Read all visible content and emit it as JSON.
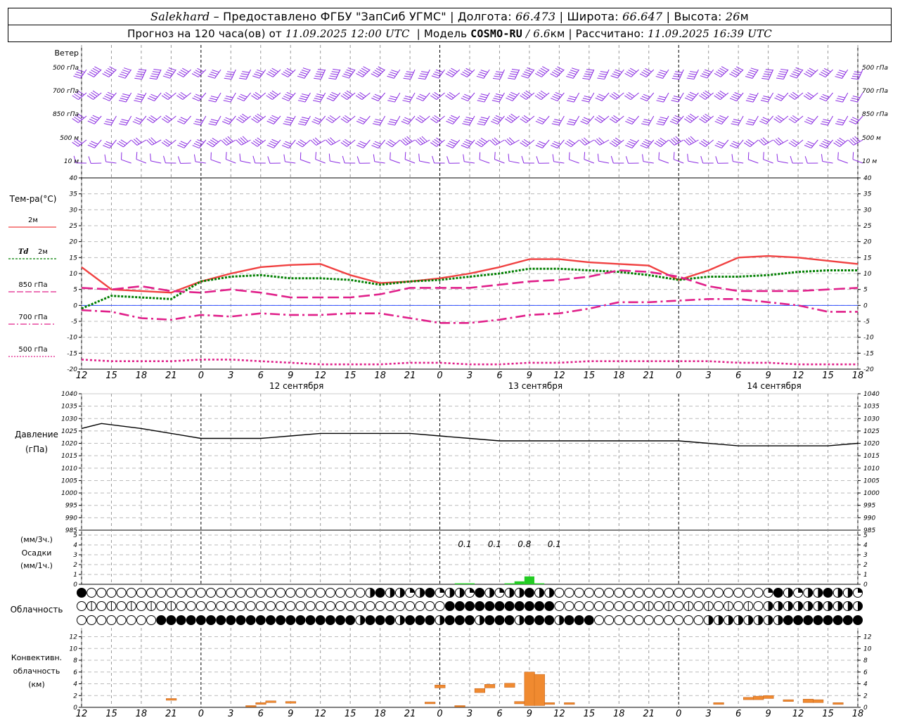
{
  "header": {
    "station": "Salekhard",
    "provided": "– Предоставлено ФГБУ \"ЗапСиб УГМС\" | Долгота:",
    "lon": "66.473",
    "lat_label": "| Широта:",
    "lat": "66.647",
    "alt_label": "| Высота:",
    "alt": "26",
    "alt_unit": "м",
    "forecast_label": "Прогноз на 120 часа(ов) от",
    "issued": "11.09.2025 12:00 UTC",
    "model_label": "| Модель",
    "model": "COSMO-RU",
    "resolution": "/ 6.6",
    "res_unit": "км",
    "calc_label": "| Рассчитано:",
    "calc": "11.09.2025 16:39 UTC"
  },
  "colors": {
    "wind": "#8a2be2",
    "t2m": "#f04040",
    "td2m": "#007f00",
    "t850": "#e0208a",
    "t700": "#e0208a",
    "t500": "#e0208a",
    "pressure": "#000000",
    "precip": "#22cc22",
    "convective": "#f08a30",
    "grid": "#999999"
  },
  "time_axis": {
    "hour_ticks": [
      "12",
      "15",
      "18",
      "21",
      "0",
      "3",
      "6",
      "9",
      "12",
      "15",
      "18",
      "21",
      "0",
      "3",
      "6",
      "9",
      "12",
      "15",
      "18",
      "21",
      "0",
      "3",
      "6",
      "9",
      "12",
      "15",
      "18"
    ],
    "day_labels": [
      "12 сентября",
      "13 сентября",
      "14 сентября"
    ]
  },
  "wind_panel": {
    "title": "Ветер",
    "levels": [
      "500 гПа",
      "700 гПа",
      "850 гПа",
      "500 м",
      "10  м"
    ],
    "right_levels": [
      "500 гПа",
      "700 гПа",
      "850 гПа",
      "500 м",
      "10  м"
    ]
  },
  "temp_panel": {
    "title": "Тем-ра(°C)",
    "legend": [
      {
        "label": "2м",
        "prefix": ""
      },
      {
        "label": "2м",
        "prefix": "Td"
      },
      {
        "label": "850 гПа",
        "prefix": ""
      },
      {
        "label": "700 гПа",
        "prefix": ""
      },
      {
        "label": "500 гПа",
        "prefix": ""
      }
    ],
    "yticks": [
      40,
      35,
      30,
      25,
      20,
      15,
      10,
      5,
      0,
      -5,
      -10,
      -15,
      -20
    ]
  },
  "pressure_panel": {
    "title": "Давление",
    "unit": "(гПа)",
    "yticks": [
      1040,
      1035,
      1030,
      1025,
      1020,
      1015,
      1010,
      1005,
      1000,
      995,
      990,
      985
    ]
  },
  "precip_panel": {
    "unit3": "(мм/3ч.)",
    "title": "Осадки",
    "unit1": "(мм/1ч.)",
    "yticks": [
      5,
      4,
      3,
      2,
      1,
      0
    ],
    "annotations": [
      "0.1",
      "0.1",
      "0.8",
      "0.1"
    ]
  },
  "cloud_panel": {
    "title": "Облачность"
  },
  "convective_panel": {
    "title1": "Конвективн.",
    "title2": "облачность",
    "unit": "(км)",
    "yticks": [
      12,
      10,
      8,
      6,
      4,
      2,
      0
    ]
  },
  "chart_data": {
    "type": "line",
    "x_hours_from_start": "0..78 (12 UTC 11 Sep to 18 UTC 14 Sep)",
    "temperature": {
      "ylim": [
        -20,
        40
      ],
      "series": [
        {
          "name": "2м",
          "x": [
            0,
            3,
            6,
            9,
            12,
            15,
            18,
            21,
            24,
            27,
            30,
            33,
            36,
            39,
            42,
            45,
            48,
            51,
            54,
            57,
            60,
            63,
            66,
            69,
            72,
            75,
            78
          ],
          "values": [
            12,
            5,
            4.5,
            4,
            7.5,
            10,
            12,
            12.7,
            13,
            9.5,
            7,
            7.5,
            8.5,
            10,
            12,
            14.5,
            14.5,
            13.5,
            13,
            12.5,
            8,
            11,
            15,
            15.5,
            15,
            14,
            13
          ]
        },
        {
          "name": "Td 2м",
          "x": [
            0,
            3,
            6,
            9,
            12,
            15,
            18,
            21,
            24,
            27,
            30,
            33,
            36,
            39,
            42,
            45,
            48,
            51,
            54,
            57,
            60,
            63,
            66,
            69,
            72,
            75,
            78
          ],
          "values": [
            -1,
            3,
            2.5,
            2,
            7.5,
            9,
            9.5,
            8.5,
            8.5,
            8,
            6.5,
            7.5,
            8,
            9,
            10,
            11.5,
            11.5,
            11,
            10.5,
            9.5,
            8,
            9,
            9,
            9.5,
            10.5,
            11,
            11
          ]
        },
        {
          "name": "850 гПа",
          "x": [
            0,
            3,
            6,
            9,
            12,
            15,
            18,
            21,
            24,
            27,
            30,
            33,
            36,
            39,
            42,
            45,
            48,
            51,
            54,
            57,
            60,
            63,
            66,
            69,
            72,
            75,
            78
          ],
          "values": [
            5.5,
            5,
            6,
            4.5,
            4,
            5,
            4,
            2.5,
            2.5,
            2.5,
            3.5,
            5.5,
            5.5,
            5.5,
            6.5,
            7.5,
            8,
            9,
            11,
            10.5,
            9,
            6,
            4.5,
            4.5,
            4.5,
            5,
            5.5
          ]
        },
        {
          "name": "700 гПа",
          "x": [
            0,
            3,
            6,
            9,
            12,
            15,
            18,
            21,
            24,
            27,
            30,
            33,
            36,
            39,
            42,
            45,
            48,
            51,
            54,
            57,
            60,
            63,
            66,
            69,
            72,
            75,
            78
          ],
          "values": [
            -1.5,
            -2,
            -4,
            -4.5,
            -3,
            -3.5,
            -2.5,
            -3,
            -3,
            -2.5,
            -2.5,
            -4,
            -5.5,
            -5.5,
            -4.5,
            -3,
            -2.5,
            -1,
            1,
            1,
            1.5,
            2,
            2,
            1,
            0,
            -2,
            -2
          ]
        },
        {
          "name": "500 гПа",
          "x": [
            0,
            3,
            6,
            9,
            12,
            15,
            18,
            21,
            24,
            27,
            30,
            33,
            36,
            39,
            42,
            45,
            48,
            51,
            54,
            57,
            60,
            63,
            66,
            69,
            72,
            75,
            78
          ],
          "values": [
            -17,
            -17.5,
            -17.5,
            -17.5,
            -17,
            -17,
            -17.5,
            -18,
            -18.5,
            -18.5,
            -18.5,
            -18,
            -18,
            -18.5,
            -18.5,
            -18,
            -18,
            -17.5,
            -17.5,
            -17.5,
            -17.5,
            -17.5,
            -18,
            -18,
            -18.5,
            -18.5,
            -18.5
          ]
        }
      ]
    },
    "pressure": {
      "ylim": [
        985,
        1040
      ],
      "x": [
        0,
        2,
        6,
        9,
        12,
        15,
        18,
        21,
        24,
        27,
        30,
        33,
        36,
        39,
        42,
        45,
        48,
        51,
        54,
        57,
        60,
        63,
        66,
        69,
        72,
        75,
        78
      ],
      "values": [
        1026,
        1028,
        1026,
        1024,
        1022,
        1022,
        1022,
        1023,
        1024,
        1024,
        1024,
        1024,
        1023,
        1022,
        1021,
        1021,
        1021,
        1021,
        1021,
        1021,
        1021,
        1020,
        1019,
        1019,
        1019,
        1019,
        1020
      ]
    },
    "precipitation": {
      "ylim": [
        0,
        5
      ],
      "x": [
        38,
        39,
        43,
        44,
        45,
        46
      ],
      "values": [
        0.1,
        0.1,
        0.1,
        0.3,
        0.8,
        0.1
      ]
    },
    "convective_cloud_km": {
      "ylim": [
        0,
        13
      ],
      "bars": [
        {
          "x": 9,
          "base": 1.2,
          "top": 1.5
        },
        {
          "x": 17,
          "base": 0.2,
          "top": 0.3
        },
        {
          "x": 18,
          "base": 0.5,
          "top": 0.8
        },
        {
          "x": 19,
          "base": 0.8,
          "top": 1.1
        },
        {
          "x": 21,
          "base": 0.7,
          "top": 1.0
        },
        {
          "x": 35,
          "base": 0.6,
          "top": 0.9
        },
        {
          "x": 36,
          "base": 3.3,
          "top": 3.8
        },
        {
          "x": 38,
          "base": 0.2,
          "top": 0.3
        },
        {
          "x": 40,
          "base": 2.5,
          "top": 3.2
        },
        {
          "x": 41,
          "base": 3.3,
          "top": 3.9
        },
        {
          "x": 43,
          "base": 3.4,
          "top": 4.1
        },
        {
          "x": 44,
          "base": 0.6,
          "top": 1.0
        },
        {
          "x": 45,
          "base": 0.3,
          "top": 6.0
        },
        {
          "x": 46,
          "base": 0.3,
          "top": 5.6
        },
        {
          "x": 47,
          "base": 0.5,
          "top": 0.8
        },
        {
          "x": 49,
          "base": 0.5,
          "top": 0.8
        },
        {
          "x": 64,
          "base": 0.5,
          "top": 0.8
        },
        {
          "x": 67,
          "base": 1.3,
          "top": 1.7
        },
        {
          "x": 68,
          "base": 1.3,
          "top": 1.9
        },
        {
          "x": 69,
          "base": 1.5,
          "top": 2.0
        },
        {
          "x": 71,
          "base": 1.0,
          "top": 1.3
        },
        {
          "x": 73,
          "base": 0.8,
          "top": 1.4
        },
        {
          "x": 74,
          "base": 0.8,
          "top": 1.3
        },
        {
          "x": 76,
          "base": 0.5,
          "top": 0.8
        }
      ]
    }
  }
}
